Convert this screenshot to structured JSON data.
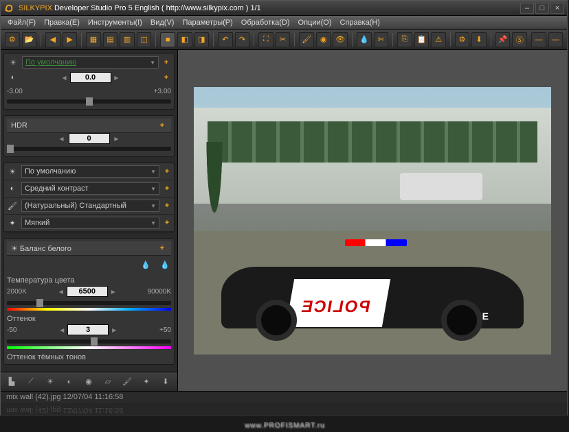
{
  "titlebar": {
    "app_name": "SILKYPIX",
    "subtitle": " Developer Studio Pro 5 English ( http://www.silkypix.com )   1/1"
  },
  "menus": {
    "file": "Файл(F)",
    "edit": "Правка(E)",
    "tools": "Инструменты(I)",
    "view": "Вид(V)",
    "params": "Параметры(P)",
    "process": "Обработка(D)",
    "options": "Опции(O)",
    "help": "Справка(H)"
  },
  "exposure": {
    "preset": "По умолчанию",
    "value": "0.0",
    "min": "-3.00",
    "max": "+3.00"
  },
  "hdr": {
    "label": "HDR",
    "value": "0"
  },
  "presets": {
    "wb": "По умолчанию",
    "contrast": "Средний контраст",
    "color": "(Натуральный) Стандартный",
    "sharpness": "Мягкий"
  },
  "white_balance": {
    "title": "Баланс белого",
    "temp_label": "Температура цвета",
    "temp_value": "6500",
    "temp_min": "2000K",
    "temp_max": "90000K",
    "tint_label": "Оттенок",
    "tint_value": "3",
    "tint_min": "-50",
    "tint_max": "+50",
    "dark_label": "Оттенок тёмных тонов"
  },
  "status": {
    "filename": "mix wall (42).jpg 12/07/04 11:16:58"
  },
  "watermark": "www.PROFISMART.ru",
  "image": {
    "police_text": "POLICE",
    "police_text2": "POLICE"
  }
}
